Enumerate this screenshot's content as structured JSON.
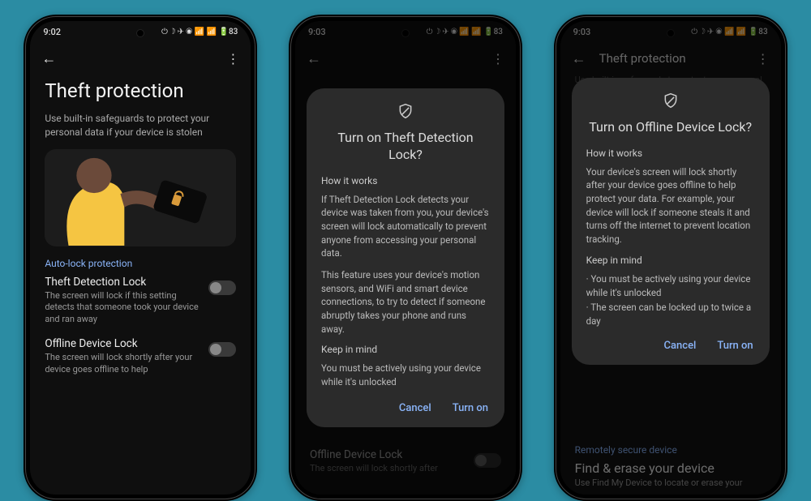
{
  "status": {
    "time1": "9:02",
    "time2": "9:03",
    "time3": "9:03",
    "icons": "⏻ ☽ ✈ ◉ 📶 📶 🔋83"
  },
  "appbar": {
    "back": "←",
    "menu": "⋮",
    "title3": "Theft protection"
  },
  "page1": {
    "title": "Theft protection",
    "subtitle": "Use built-in safeguards to protect your personal data if your device is stolen",
    "section": "Auto-lock protection",
    "s1_title": "Theft Detection Lock",
    "s1_desc": "The screen will lock if this setting detects that someone took your device and ran away",
    "s2_title": "Offline Device Lock",
    "s2_desc": "The screen will lock shortly after your device goes offline to help"
  },
  "dialog2": {
    "title": "Turn on Theft Detection Lock?",
    "h1": "How it works",
    "p1": "If Theft Detection Lock detects your device was taken from you, your device's screen will lock automatically to prevent anyone from accessing your personal data.",
    "p2": "This feature uses your device's motion sensors, and WiFi and smart device connections, to try to detect if someone abruptly takes your phone and runs away.",
    "h2": "Keep in mind",
    "p3": "You must be actively using your device while it's unlocked",
    "cancel": "Cancel",
    "confirm": "Turn on"
  },
  "behind2": {
    "s2_title": "Offline Device Lock",
    "s2_desc": "The screen will lock shortly after"
  },
  "page3_top": {
    "faded": "Use built-in safeguards to protect your personal data if your device is stolen"
  },
  "dialog3": {
    "title": "Turn on Offline Device Lock?",
    "h1": "How it works",
    "p1": "Your device's screen will lock shortly after your device goes offline to help protect your data. For example, your device will lock if someone steals it and turns off the internet to prevent location tracking.",
    "h2": "Keep in mind",
    "li1": "· You must be actively using your device while it's unlocked",
    "li2": "· The screen can be locked up to twice a day",
    "cancel": "Cancel",
    "confirm": "Turn on"
  },
  "page3_bottom": {
    "remotely": "Remotely secure device",
    "find_title": "Find & erase your device",
    "find_desc": "Use Find My Device to locate or erase your"
  }
}
